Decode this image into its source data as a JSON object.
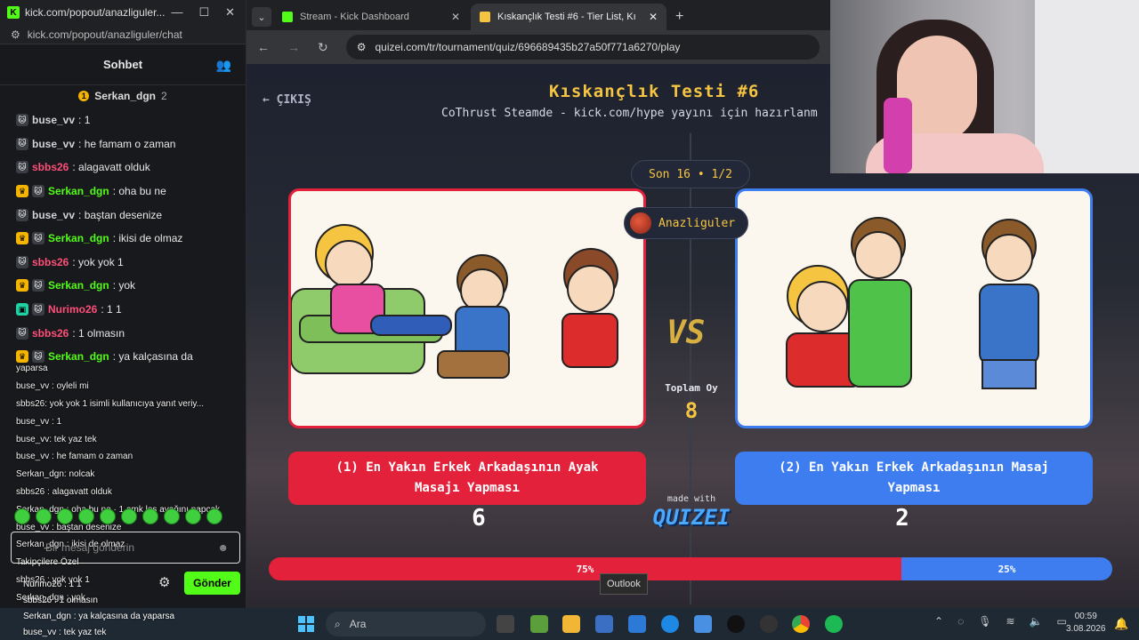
{
  "kick": {
    "window_url": "kick.com/popout/anazliguler...",
    "address": "kick.com/popout/anazliguler/chat",
    "header": "Sohbet",
    "pinned_user": "Serkan_dgn",
    "pinned_count": "2",
    "messages": [
      {
        "user": "buse_vv",
        "text": ": 1",
        "color": "#cfd2d8",
        "badge": "cat"
      },
      {
        "user": "buse_vv",
        "text": ": he famam o zaman",
        "color": "#cfd2d8",
        "badge": "cat"
      },
      {
        "user": "sbbs26",
        "text": ": alagavatt olduk",
        "color": "#ff4e7a",
        "badge": "cat"
      },
      {
        "user": "Serkan_dgn",
        "text": ": oha bu ne",
        "color": "#53fc18",
        "badge": "gift"
      },
      {
        "user": "buse_vv",
        "text": ": baştan desenize",
        "color": "#cfd2d8",
        "badge": "cat"
      },
      {
        "user": "Serkan_dgn",
        "text": ": ikisi de olmaz",
        "color": "#53fc18",
        "badge": "gift"
      },
      {
        "user": "sbbs26",
        "text": ": yok yok 1",
        "color": "#ff4e7a",
        "badge": "cat"
      },
      {
        "user": "Serkan_dgn",
        "text": ": yok",
        "color": "#53fc18",
        "badge": "gift"
      },
      {
        "user": "Nurimo26",
        "text": ": 1 1",
        "color": "#ff4e7a",
        "badge": "mod"
      },
      {
        "user": "sbbs26",
        "text": ": 1 olmasın",
        "color": "#ff4e7a",
        "badge": "cat"
      },
      {
        "user": "Serkan_dgn",
        "text": ": ya kalçasına da",
        "color": "#53fc18",
        "badge": "gift"
      }
    ],
    "overlay_lines": [
      "yaparsa",
      "buse_vv : oyleli mi",
      "sbbs26: yok yok 1 isimli kullanıcıya yanıt veriy...",
      "buse_vv : 1",
      "buse_vv: tek yaz tek",
      "buse_vv : he famam o zaman",
      "Serkan_dgn: nolcak",
      "sbbs26 : alagavatt olduk",
      "Serkan_dgn : oha bu ne · 1 amk leş ayağını napcak",
      "buse_vv : baştan desenize",
      "Serkan_dgn : ikisi de olmaz",
      "Takipçilere Özel",
      "sbbs26 : yok yok 1",
      "Serkan_dgn : yok"
    ],
    "overlay_bottom": [
      "Nurimo26 : 1 1",
      "sbbs26 : 1 olmasın",
      "Serkan_dgn : ya kalçasına da yaparsa",
      "buse_vv : tek yaz tek"
    ],
    "input_placeholder": "Bir mesaj gönderin",
    "send_label": "Gönder"
  },
  "browser": {
    "tabs": [
      {
        "label": "Stream - Kick Dashboard",
        "fav_color": "#53fc18"
      },
      {
        "label": "Kıskançlık Testi #6 - Tier List, Kı",
        "fav_color": "#f5c542"
      }
    ],
    "url": "quizei.com/tr/tournament/quiz/696689435b27a50f771a6270/play"
  },
  "quiz": {
    "exit_label": "← ÇIKIŞ",
    "title": "Kıskançlık Testi #6",
    "subtitle": "CoThrust Steamde - kick.com/hype yayını için hazırlanm",
    "round": "Son 16 • 1/2",
    "streamer": "Anazliguler",
    "vs": "VS",
    "total_label": "Toplam Oy",
    "total_value": "8",
    "left_option": "(1) En Yakın Erkek Arkadaşının Ayak Masajı Yapması",
    "right_option": "(2) En Yakın Erkek Arkadaşının Masaj Yapması",
    "left_votes": "6",
    "right_votes": "2",
    "made_with": "made with",
    "brand": "QUIZEI",
    "left_pct_label": "75%",
    "right_pct_label": "25%",
    "left_share": 0.75,
    "tooltip": "Outlook"
  },
  "taskbar": {
    "search": "Ara",
    "time": "00:59",
    "date": "3.08.2026"
  }
}
